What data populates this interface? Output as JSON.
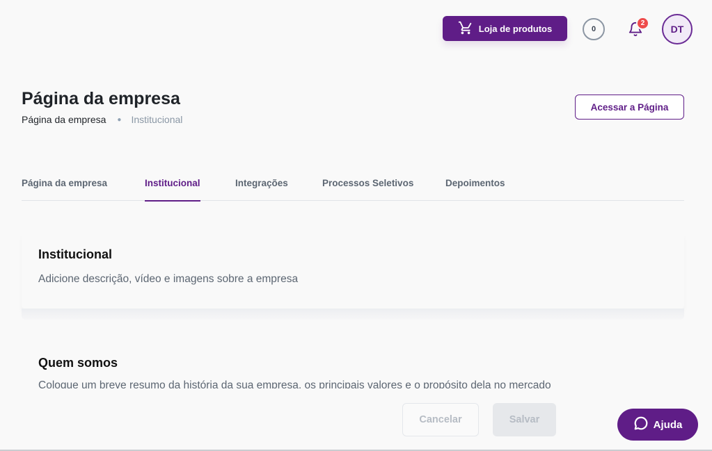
{
  "header": {
    "store_label": "Loja de produtos",
    "coins": "0",
    "notifications_count": "2",
    "avatar_initials": "DT"
  },
  "page": {
    "title": "Página da empresa",
    "breadcrumb": [
      "Página da empresa",
      "Institucional"
    ],
    "access_label": "Acessar a Página"
  },
  "tabs": [
    {
      "label": "Página da empresa",
      "active": false
    },
    {
      "label": "Institucional",
      "active": true
    },
    {
      "label": "Integrações",
      "active": false
    },
    {
      "label": "Processos Seletivos",
      "active": false
    },
    {
      "label": "Depoimentos",
      "active": false
    }
  ],
  "institucional": {
    "title": "Institucional",
    "description": "Adicione descrição, vídeo e imagens sobre a empresa"
  },
  "quem_somos": {
    "title": "Quem somos",
    "description": "Coloque um breve resumo da história da sua empresa, os principais valores e o propósito dela no mercado"
  },
  "footer": {
    "cancel_label": "Cancelar",
    "save_label": "Salvar",
    "help_label": "Ajuda"
  },
  "colors": {
    "brand": "#5f1d87",
    "badge": "#ee4b4b",
    "background": "#f9f9f9"
  },
  "icons": {
    "store": "cart-icon",
    "notifications": "bell-icon",
    "help": "chat-bubble-icon"
  }
}
